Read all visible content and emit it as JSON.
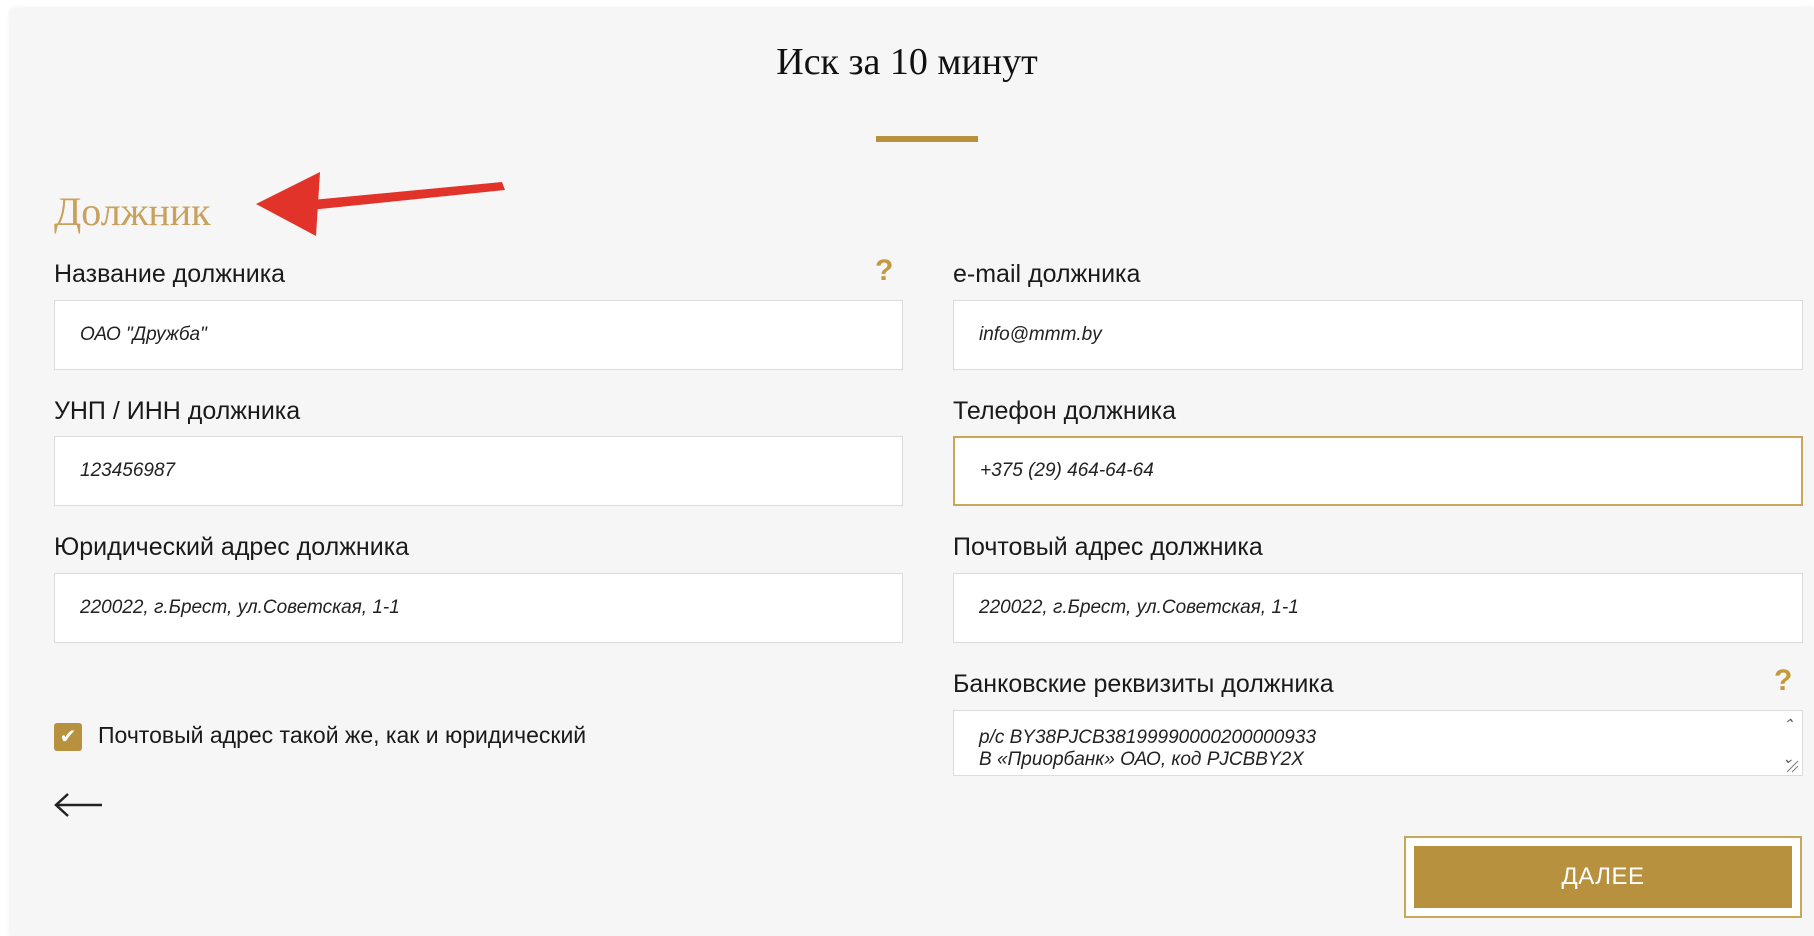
{
  "page": {
    "title": "Иск за 10 минут",
    "section_heading": "Должник"
  },
  "colors": {
    "accent": "#b8913f",
    "heading": "#c9a15c",
    "annotation_arrow": "#e2332b"
  },
  "fields": {
    "debtor_name": {
      "label": "Название должника",
      "value": "ОАО \"Дружба\"",
      "help": "?"
    },
    "debtor_email": {
      "label": "e-mail должника",
      "value": "info@mmm.by"
    },
    "debtor_unp": {
      "label": "УНП / ИНН должника",
      "value": "123456987"
    },
    "debtor_phone": {
      "label": "Телефон должника",
      "value": "+375 (29) 464-64-64"
    },
    "debtor_legal_address": {
      "label": "Юридический адрес должника",
      "value": "220022, г.Брест, ул.Советская, 1-1"
    },
    "debtor_postal_address": {
      "label": "Почтовый адрес должника",
      "value": "220022, г.Брест, ул.Советская, 1-1"
    },
    "debtor_bank_details": {
      "label": "Банковские реквизиты должника",
      "help": "?",
      "lines": [
        "р/с BY38PJCB38199990000200000933",
        "В «Приорбанк» ОАО, код PJCBBY2X"
      ]
    }
  },
  "checkbox": {
    "label": "Почтовый адрес такой же, как и юридический",
    "checked": true
  },
  "icons": {
    "back": "arrow-left-icon",
    "check": "checkmark-icon"
  },
  "buttons": {
    "next_label": "ДАЛЕЕ"
  }
}
